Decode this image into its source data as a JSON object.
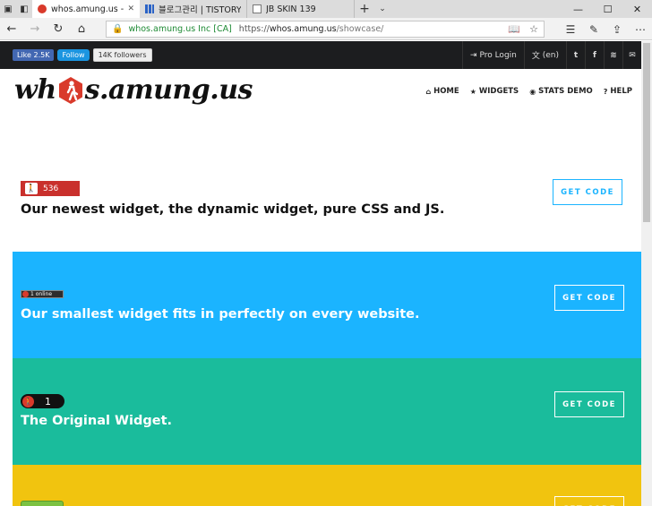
{
  "browser": {
    "tabs": [
      {
        "title": "whos.amung.us - showc",
        "active": true
      },
      {
        "title": "블로그관리 | TISTORY",
        "active": false
      },
      {
        "title": "JB SKIN 139",
        "active": false
      }
    ],
    "address": {
      "org": "whos.amung.us Inc [CA]",
      "url_scheme": "https://",
      "url_host": "whos.amung.us",
      "url_path": "/showcase/"
    }
  },
  "topbar": {
    "fb_like": "Like 2.5K",
    "tw_follow": "Follow",
    "followers": "14K followers",
    "pro_login": "Pro Login",
    "lang": "(en)"
  },
  "logo": {
    "left": "wh",
    "right": "s.amung.us"
  },
  "nav": [
    {
      "label": "HOME",
      "icon": "home-icon",
      "glyph": "⌂"
    },
    {
      "label": "WIDGETS",
      "icon": "star-icon",
      "glyph": "★"
    },
    {
      "label": "STATS DEMO",
      "icon": "user-circle-icon",
      "glyph": "◉"
    },
    {
      "label": "HELP",
      "icon": "question-icon",
      "glyph": "?"
    }
  ],
  "showcase": [
    {
      "widget_value": "536",
      "headline": "Our newest widget, the dynamic widget, pure CSS and JS.",
      "button": "GET CODE"
    },
    {
      "widget_value": "1 online",
      "headline": "Our smallest widget fits in perfectly on every website.",
      "button": "GET CODE"
    },
    {
      "widget_value": "1",
      "headline": "The Original Widget.",
      "button": "GET CODE"
    },
    {
      "button": "GET CODE"
    }
  ],
  "colors": {
    "dynamic_red": "#c9302c",
    "blue": "#1bb4ff",
    "teal": "#1abc9c",
    "yellow": "#f1c40f",
    "topbar": "#1c1d1f"
  }
}
